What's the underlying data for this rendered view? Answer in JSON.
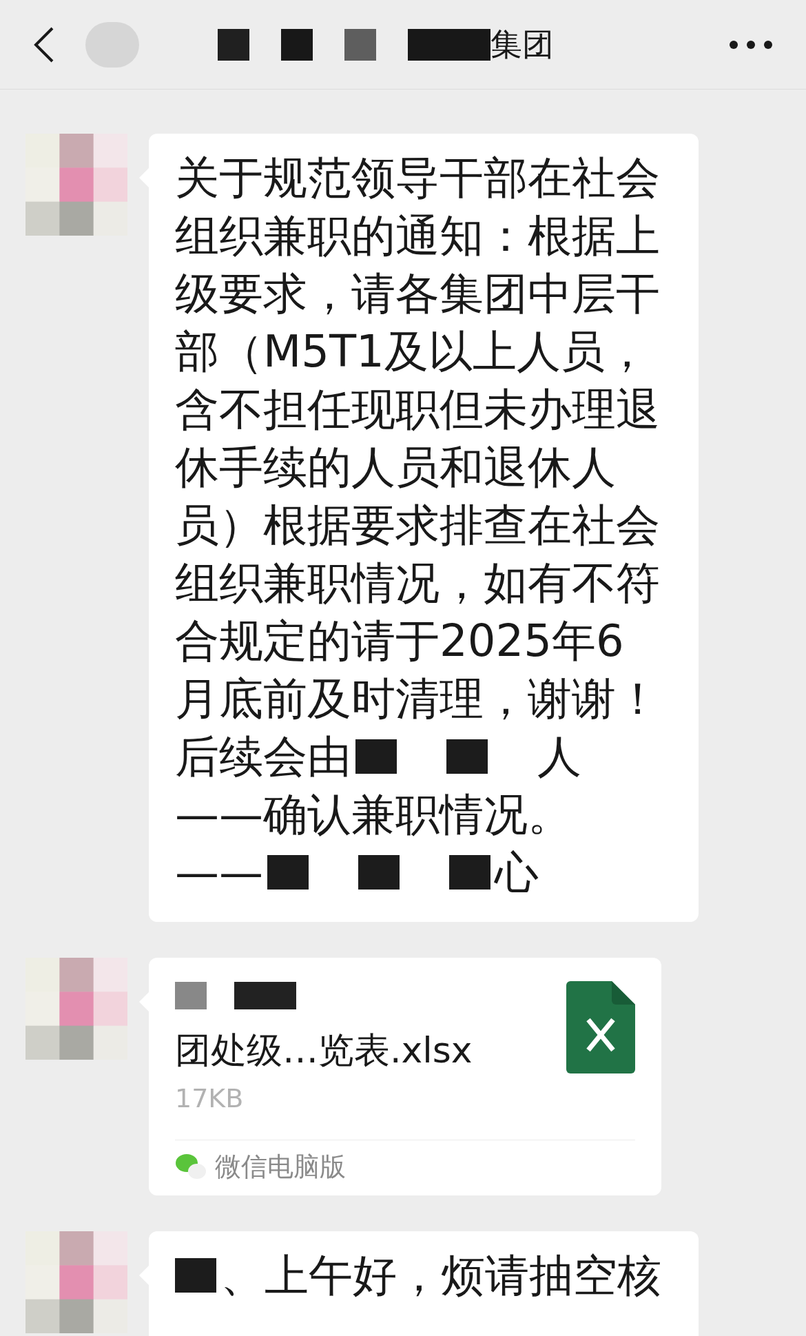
{
  "header": {
    "title": "集团"
  },
  "messages": [
    {
      "kind": "text",
      "lines": [
        [
          {
            "kind": "text",
            "text": "关于规范领导干部在社会"
          }
        ],
        [
          {
            "kind": "text",
            "text": "组织兼职的通知：根据上"
          }
        ],
        [
          {
            "kind": "text",
            "text": "级要求，请各集团中层干"
          }
        ],
        [
          {
            "kind": "text",
            "text": "部（M5T1及以上人员，"
          }
        ],
        [
          {
            "kind": "text",
            "text": "含不担任现职但未办理退"
          }
        ],
        [
          {
            "kind": "text",
            "text": "休手续的人员和退休人"
          }
        ],
        [
          {
            "kind": "text",
            "text": "员）根据要求排查在社会"
          }
        ],
        [
          {
            "kind": "text",
            "text": "组织兼职情况，如有不符"
          }
        ],
        [
          {
            "kind": "text",
            "text": "合规定的请于2025年6"
          }
        ],
        [
          {
            "kind": "text",
            "text": "月底前及时清理，谢谢！"
          }
        ],
        [
          {
            "kind": "text",
            "text": "后续会由"
          },
          {
            "kind": "redacted"
          },
          {
            "kind": "gap"
          },
          {
            "kind": "redacted"
          },
          {
            "kind": "gap"
          },
          {
            "kind": "text",
            "text": "人"
          }
        ],
        [
          {
            "kind": "text",
            "text": "——确认兼职情况。"
          }
        ],
        [
          {
            "kind": "text",
            "text": "——"
          },
          {
            "kind": "redacted"
          },
          {
            "kind": "gap"
          },
          {
            "kind": "redacted"
          },
          {
            "kind": "gap"
          },
          {
            "kind": "redacted"
          },
          {
            "kind": "text",
            "text": "心"
          }
        ]
      ]
    },
    {
      "kind": "file",
      "name": "团处级…览表.xlsx",
      "size": "17KB",
      "source": "微信电脑版"
    },
    {
      "kind": "text",
      "lines": [
        [
          {
            "kind": "redacted"
          },
          {
            "kind": "text",
            "text": "、上午好，烦请抽空核"
          }
        ]
      ]
    }
  ]
}
